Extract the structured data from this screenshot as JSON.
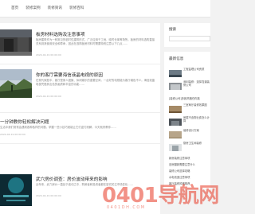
{
  "nav": {
    "items": [
      "首页",
      "装修案例",
      "装修资讯",
      "装修百科"
    ]
  },
  "articles": [
    {
      "title": "板房材料选购及注意事项",
      "excerpt": "板房建筑作为一种常见的临时性建筑形式，广泛应用于工地、临时仓库等场所。板房的材料选购直接关系到其使用安全和寿命，因此在选购板房材料时需要特别注意以下几点……",
      "date": "2024-04-19 00:00:00"
    },
    {
      "title": "你的客厅需要海信液晶电视的原因",
      "excerpt": "在现代家庭中，客厅是家人团聚、休闲娱乐的重要空间，一台好的电视能为客厅增色不少。海信液晶电视凭借其出色的画质和丰富的功能……",
      "date": "2024-04-19 00:00:00"
    },
    {
      "title": "一分钟教你轻松解决问题",
      "excerpt": "生活中我们常常会遇到各种各样的问题，掌握一些小技巧就能让它们迎刃而解，今天就来教你……",
      "date": "2024-04-19 00:00:00"
    },
    {
      "title": "武穴房价调查：房价波动带来的影响",
      "excerpt": "近年来，武穴房价一直处于波动之中，购房者和投资者都在密切关注市场变化……",
      "date": "2024-04-19 00:00:00"
    }
  ],
  "sidebar": {
    "search_title": "搜索",
    "recent_title": "最新信息",
    "recent_items": [
      "工程监理公司资质",
      "深圳装修：选择靠谱装修公司",
      "[装修公司]多款风格任你挑",
      "三室两厅装修效果图",
      "房屋不含物业费怎么计算",
      "装修设计方案",
      "厨房卫生间装修"
    ],
    "recent_lines": [
      "新房装修注意事项",
      "旧房翻新需要注意什么",
      "装修公司选择攻略",
      "水电改造注意事项",
      "客厅装修风格推荐"
    ]
  },
  "watermark": {
    "text": "0401导航网",
    "sub": "0401DH.COM"
  },
  "colors": {
    "accent": "#e83925",
    "background": "#f2f2f2",
    "card": "#ffffff"
  }
}
